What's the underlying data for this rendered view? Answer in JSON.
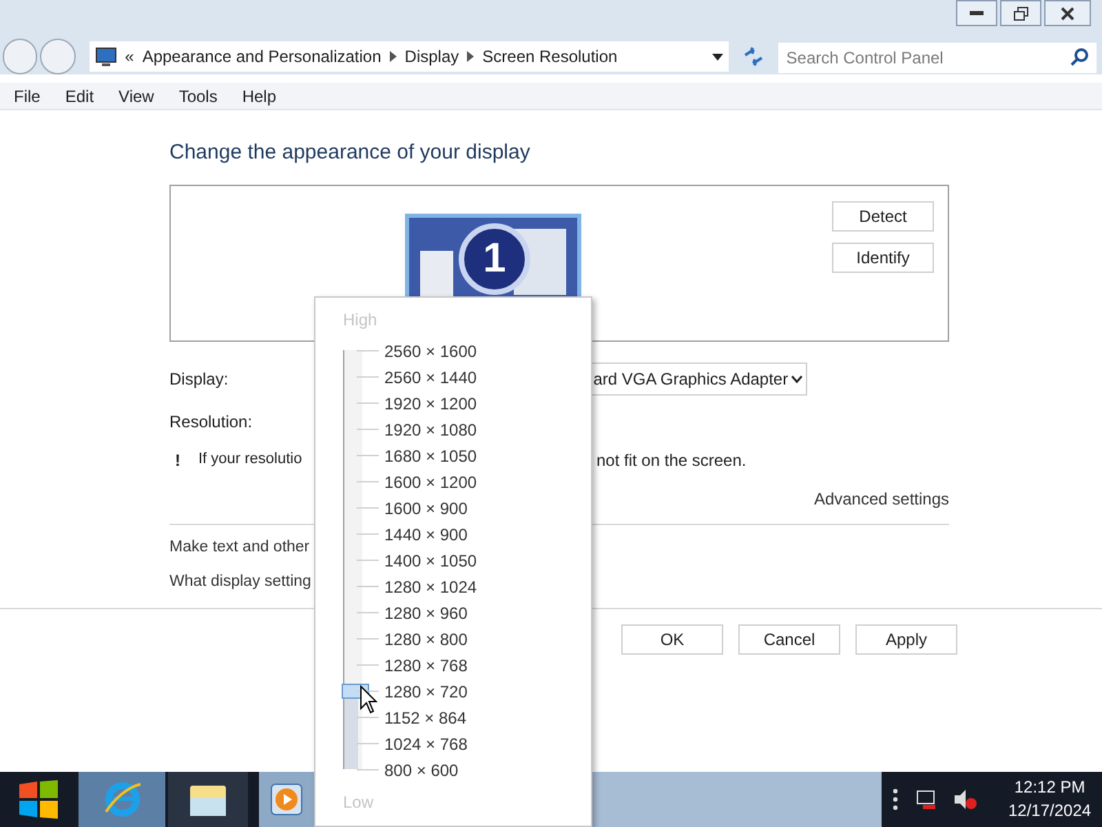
{
  "address_bar": {
    "overflow_glyph": "«",
    "breadcrumbs": [
      "Appearance and Personalization",
      "Display",
      "Screen Resolution"
    ]
  },
  "search": {
    "placeholder": "Search Control Panel"
  },
  "menu": [
    "File",
    "Edit",
    "View",
    "Tools",
    "Help"
  ],
  "heading": "Change the appearance of your display",
  "monitor_panel": {
    "monitor_number": "1",
    "buttons": [
      "Detect",
      "Identify"
    ]
  },
  "display_row": {
    "label": "Display:",
    "value": "ard VGA Graphics Adapter"
  },
  "resolution_row": {
    "label": "Resolution:"
  },
  "warning": {
    "icon": "!",
    "text_left": "If your resolutio",
    "text_right": "not fit on the screen."
  },
  "advanced_link": "Advanced settings",
  "links": [
    "Make text and other",
    "What display setting"
  ],
  "buttons": [
    "OK",
    "Cancel",
    "Apply"
  ],
  "resolution_popup": {
    "high_label": "High",
    "low_label": "Low",
    "level": 0.1875,
    "options": [
      "2560 × 1600",
      "2560 × 1440",
      "1920 × 1200",
      "1920 × 1080",
      "1680 × 1050",
      "1600 × 1200",
      "1600 × 900",
      "1440 × 900",
      "1400 × 1050",
      "1280 × 1024",
      "1280 × 960",
      "1280 × 800",
      "1280 × 768",
      "1280 × 720",
      "1152 × 864",
      "1024 × 768",
      "800 × 600"
    ]
  },
  "taskbar": {
    "time": "12:12 PM",
    "date": "12/17/2024"
  }
}
